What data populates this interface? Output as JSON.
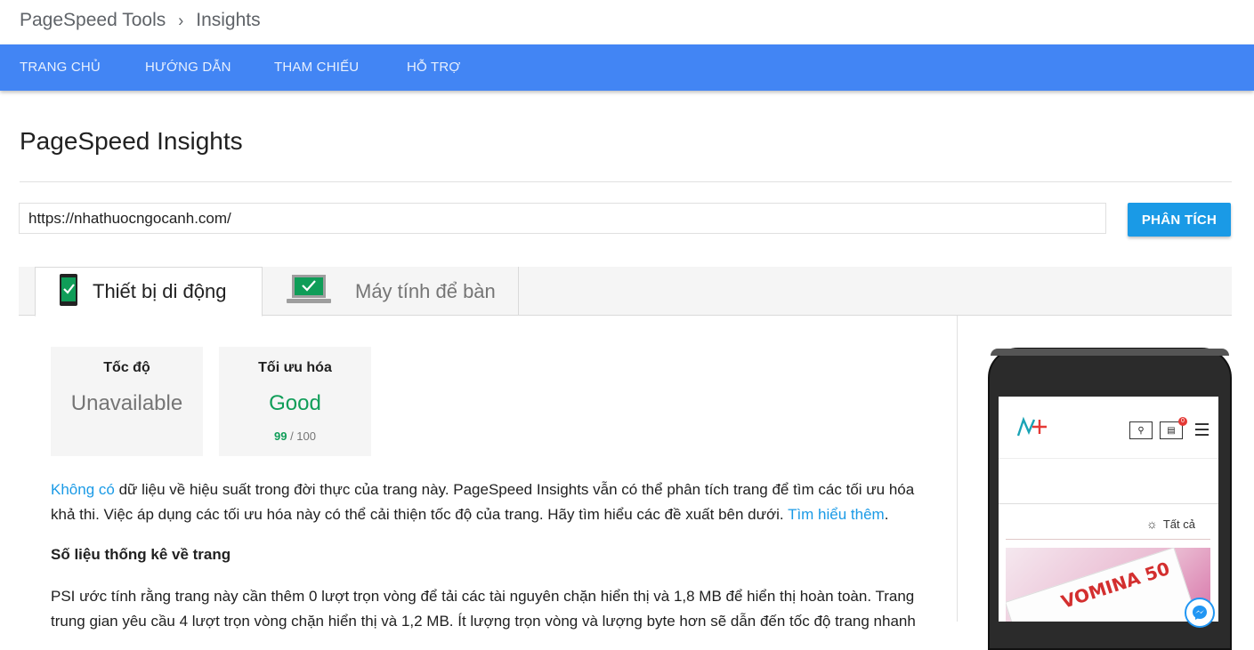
{
  "breadcrumb": {
    "root": "PageSpeed Tools",
    "separator": "›",
    "current": "Insights"
  },
  "nav": {
    "items": [
      "TRANG CHỦ",
      "HƯỚNG DẪN",
      "THAM CHIẾU",
      "HỖ TRỢ"
    ]
  },
  "page": {
    "title": "PageSpeed Insights"
  },
  "search": {
    "url_value": "https://nhathuocngocanh.com/",
    "button_label": "PHÂN TÍCH"
  },
  "tabs": {
    "mobile_label": "Thiết bị di động",
    "desktop_label": "Máy tính để bàn"
  },
  "cards": {
    "speed": {
      "title": "Tốc độ",
      "value": "Unavailable",
      "value_color": "#757575"
    },
    "optimization": {
      "title": "Tối ưu hóa",
      "value": "Good",
      "value_color": "#0f9d58",
      "score": "99",
      "score_max": "/ 100"
    }
  },
  "content": {
    "p1_link": "Không có",
    "p1_text": " dữ liệu về hiệu suất trong đời thực của trang này. PageSpeed Insights vẫn có thể phân tích trang để tìm các tối ưu hóa khả thi. Việc áp dụng các tối ưu hóa này có thể cải thiện tốc độ của trang. Hãy tìm hiểu các đề xuất bên dưới. ",
    "p1_link2": "Tìm hiểu thêm",
    "p1_end": ".",
    "stats_heading": "Số liệu thống kê về trang",
    "p2_text": "PSI ước tính rằng trang này cần thêm 0 lượt trọn vòng để tải các tài nguyên chặn hiển thị và 1,8 MB để hiển thị hoàn toàn. Trang trung gian yêu cầu 4 lượt trọn vòng chặn hiển thị và 1,2 MB. Ít lượng trọn vòng và lượng byte hơn sẽ dẫn đến tốc độ trang nhanh"
  },
  "preview": {
    "filter_label": "Tất cả",
    "cart_count": "0",
    "product_text": "VOMINA 50"
  },
  "colors": {
    "nav_bg": "#4285f4",
    "button_bg": "#1a9ae6",
    "good": "#0f9d58",
    "link": "#1a9ae6"
  }
}
